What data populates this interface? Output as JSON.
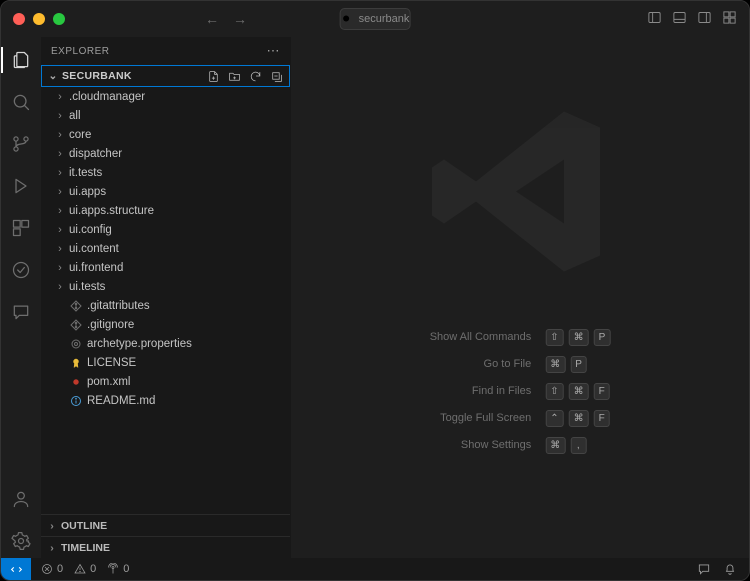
{
  "titlebar": {
    "search_text": "securbank"
  },
  "sidebar": {
    "title": "EXPLORER",
    "project": "SECURBANK",
    "folders": [
      ".cloudmanager",
      "all",
      "core",
      "dispatcher",
      "it.tests",
      "ui.apps",
      "ui.apps.structure",
      "ui.config",
      "ui.content",
      "ui.frontend",
      "ui.tests"
    ],
    "files": [
      {
        "name": ".gitattributes",
        "icon": "git",
        "color": "#6e6e6e"
      },
      {
        "name": ".gitignore",
        "icon": "git",
        "color": "#6e6e6e"
      },
      {
        "name": "archetype.properties",
        "icon": "gear",
        "color": "#6e6e6e"
      },
      {
        "name": "LICENSE",
        "icon": "cert",
        "color": "#e8bb3a"
      },
      {
        "name": "pom.xml",
        "icon": "xml",
        "color": "#c0392b"
      },
      {
        "name": "README.md",
        "icon": "info",
        "color": "#4a9cd6"
      }
    ],
    "outline": "OUTLINE",
    "timeline": "TIMELINE"
  },
  "shortcuts": [
    {
      "label": "Show All Commands",
      "keys": [
        "⇧",
        "⌘",
        "P"
      ]
    },
    {
      "label": "Go to File",
      "keys": [
        "⌘",
        "P"
      ]
    },
    {
      "label": "Find in Files",
      "keys": [
        "⇧",
        "⌘",
        "F"
      ]
    },
    {
      "label": "Toggle Full Screen",
      "keys": [
        "⌃",
        "⌘",
        "F"
      ]
    },
    {
      "label": "Show Settings",
      "keys": [
        "⌘",
        ","
      ]
    }
  ],
  "status": {
    "errors": "0",
    "warnings": "0",
    "ports": "0"
  }
}
